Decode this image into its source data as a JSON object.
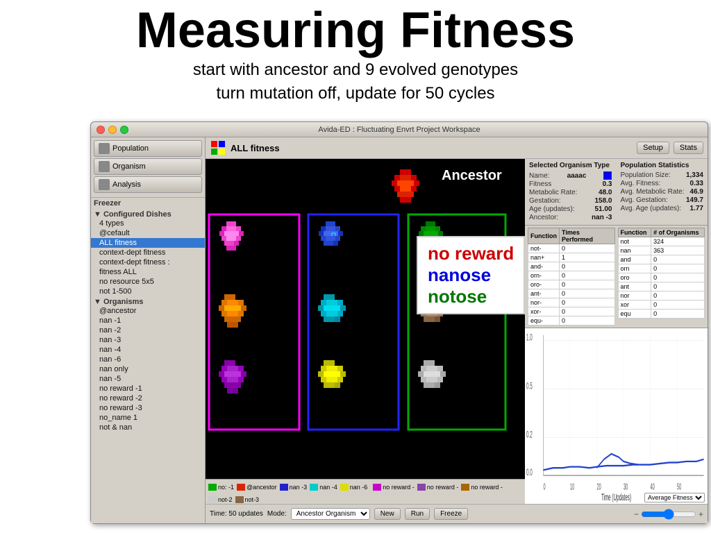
{
  "title": {
    "main": "Measuring Fitness",
    "subtitle1": "start with ancestor and 9 evolved genotypes",
    "subtitle2": "turn mutation off, update for 50 cycles"
  },
  "app": {
    "titlebar": "Avida-ED : Fluctuating Envrt Project Workspace",
    "toolbar": {
      "icon_label": "grid-icon",
      "title": "ALL fitness",
      "setup_btn": "Setup",
      "stats_btn": "Stats"
    }
  },
  "sidebar": {
    "nav_buttons": [
      {
        "label": "Population",
        "icon": "population-icon"
      },
      {
        "label": "Organism",
        "icon": "organism-icon"
      },
      {
        "label": "Analysis",
        "icon": "analysis-icon"
      }
    ],
    "freezer_label": "Freezer",
    "configured_dishes_label": "Configured Dishes",
    "configured_dishes": [
      "4 types",
      "@cefault",
      "ALL fitness",
      "context-dept fitness",
      "context-dept fitness :",
      "fitness ALL",
      "no resource 5x5",
      "not 1-500"
    ],
    "organisms_label": "Organisms",
    "organisms": [
      "@ancestor",
      "nan -1",
      "nan -2",
      "nan -3",
      "nan -4",
      "nan -6",
      "nan only",
      "nan -5",
      "no reward -1",
      "no reward -2",
      "no reward -3",
      "no_name 1",
      "not & nan"
    ]
  },
  "selected_organism": {
    "panel_title": "Selected Organism Type",
    "name_label": "Name:",
    "name_value": "aaaac",
    "fitness_label": "Fitness",
    "fitness_value": "0.3",
    "metabolic_label": "Metabolic Rate:",
    "metabolic_value": "48.0",
    "gestation_label": "Gestation:",
    "gestation_value": "158.0",
    "age_label": "Age (updates):",
    "age_value": "51.00",
    "ancestor_label": "Ancestor:",
    "ancestor_value": "nan -3"
  },
  "population_stats": {
    "panel_title": "Population Statistics",
    "size_label": "Population Size:",
    "size_value": "1,334",
    "fitness_label": "Avg. Fitness:",
    "fitness_value": "0.33",
    "metabolic_label": "Avg. Metabolic Rate:",
    "metabolic_value": "46.9",
    "gestation_label": "Avg. Gestation:",
    "gestation_value": "149.7",
    "age_label": "Avg. Age (updates):",
    "age_value": "1.77"
  },
  "function_table1": {
    "col1": "Function",
    "col2": "Times Performed",
    "rows": [
      {
        "func": "not-",
        "times": "0"
      },
      {
        "func": "nan+",
        "times": "1"
      },
      {
        "func": "and-",
        "times": "0"
      },
      {
        "func": "orn-",
        "times": "0"
      },
      {
        "func": "oro-",
        "times": "0"
      },
      {
        "func": "ant-",
        "times": "0"
      },
      {
        "func": "nor-",
        "times": "0"
      },
      {
        "func": "xor-",
        "times": "0"
      },
      {
        "func": "equ-",
        "times": "0"
      }
    ]
  },
  "function_table2": {
    "col1": "Function",
    "col2": "# of Organisms",
    "rows": [
      {
        "func": "not",
        "count": "324"
      },
      {
        "func": "nan",
        "count": "363"
      },
      {
        "func": "and",
        "count": "0"
      },
      {
        "func": "orn",
        "count": "0"
      },
      {
        "func": "oro",
        "count": "0"
      },
      {
        "func": "ant",
        "count": "0"
      },
      {
        "func": "nor",
        "count": "0"
      },
      {
        "func": "xor",
        "count": "0"
      },
      {
        "func": "equ",
        "count": "0"
      }
    ]
  },
  "ancestor_label": "Ancestor",
  "overlay": {
    "line1": "no reward",
    "line2": "nanose",
    "line3": "notose"
  },
  "legend": [
    {
      "color": "#00aa00",
      "label": "no: -1"
    },
    {
      "color": "#dd2200",
      "label": "@ancestor"
    },
    {
      "color": "#2222cc",
      "label": "nan -3"
    },
    {
      "color": "#00cccc",
      "label": "nan -4"
    },
    {
      "color": "#dddd00",
      "label": "nan -6"
    },
    {
      "color": "#cc00cc",
      "label": "no reward -"
    },
    {
      "color": "#8844aa",
      "label": "no reward -"
    },
    {
      "color": "#aa6600",
      "label": "no reward -"
    },
    {
      "color": "#cccccc",
      "label": "not-2"
    },
    {
      "color": "#886644",
      "label": "not-3"
    }
  ],
  "graph": {
    "y_max": "1.0",
    "y_mid": "0.2",
    "y_low": "0.0",
    "x_label": "Time (Updates)",
    "x_ticks": [
      "0",
      "10",
      "20",
      "30",
      "40",
      "50"
    ],
    "dropdown_label": "Average Fitness"
  },
  "bottom_bar": {
    "time_label": "Time: 50 updates",
    "mode_label": "Mode:",
    "mode_value": "Ancestor Organism",
    "new_btn": "New",
    "run_btn": "Run",
    "freeze_btn": "Freeze"
  }
}
